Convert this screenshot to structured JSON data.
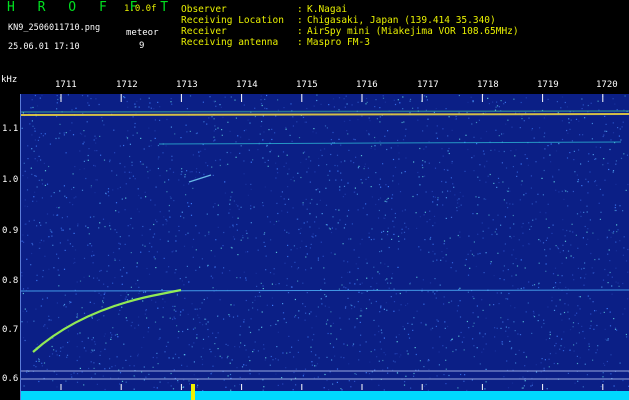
{
  "header": {
    "app_title": "H R O F F T",
    "version": "1.0.0f",
    "filename": "KN9_2506011710.png",
    "datetime": "25.06.01 17:10",
    "mode_label": "meteor",
    "mode_value": "9"
  },
  "metadata": [
    {
      "label": "Observer",
      "value": "K.Nagai"
    },
    {
      "label": "Receiving Location",
      "value": "Chigasaki, Japan (139.414 35.340)"
    },
    {
      "label": "Receiver",
      "value": "AirSpy mini (Miakejima VOR 108.65MHz)"
    },
    {
      "label": "Receiving antenna",
      "value": "Maspro FM-3"
    }
  ],
  "separator": ":",
  "axis": {
    "unit": "kHz",
    "y_ticks": [
      "1.1",
      "1.0",
      "0.9",
      "0.8",
      "0.7",
      "0.6"
    ],
    "x_ticks": [
      "1711",
      "1712",
      "1713",
      "1714",
      "1715",
      "1716",
      "1717",
      "1718",
      "1719",
      "1720"
    ]
  },
  "colors": {
    "background": "#0b1f86",
    "carrier": "#e8d040",
    "title": "#00e020",
    "label_yellow": "#e8f000",
    "noise_bar": "#00d8ff"
  }
}
